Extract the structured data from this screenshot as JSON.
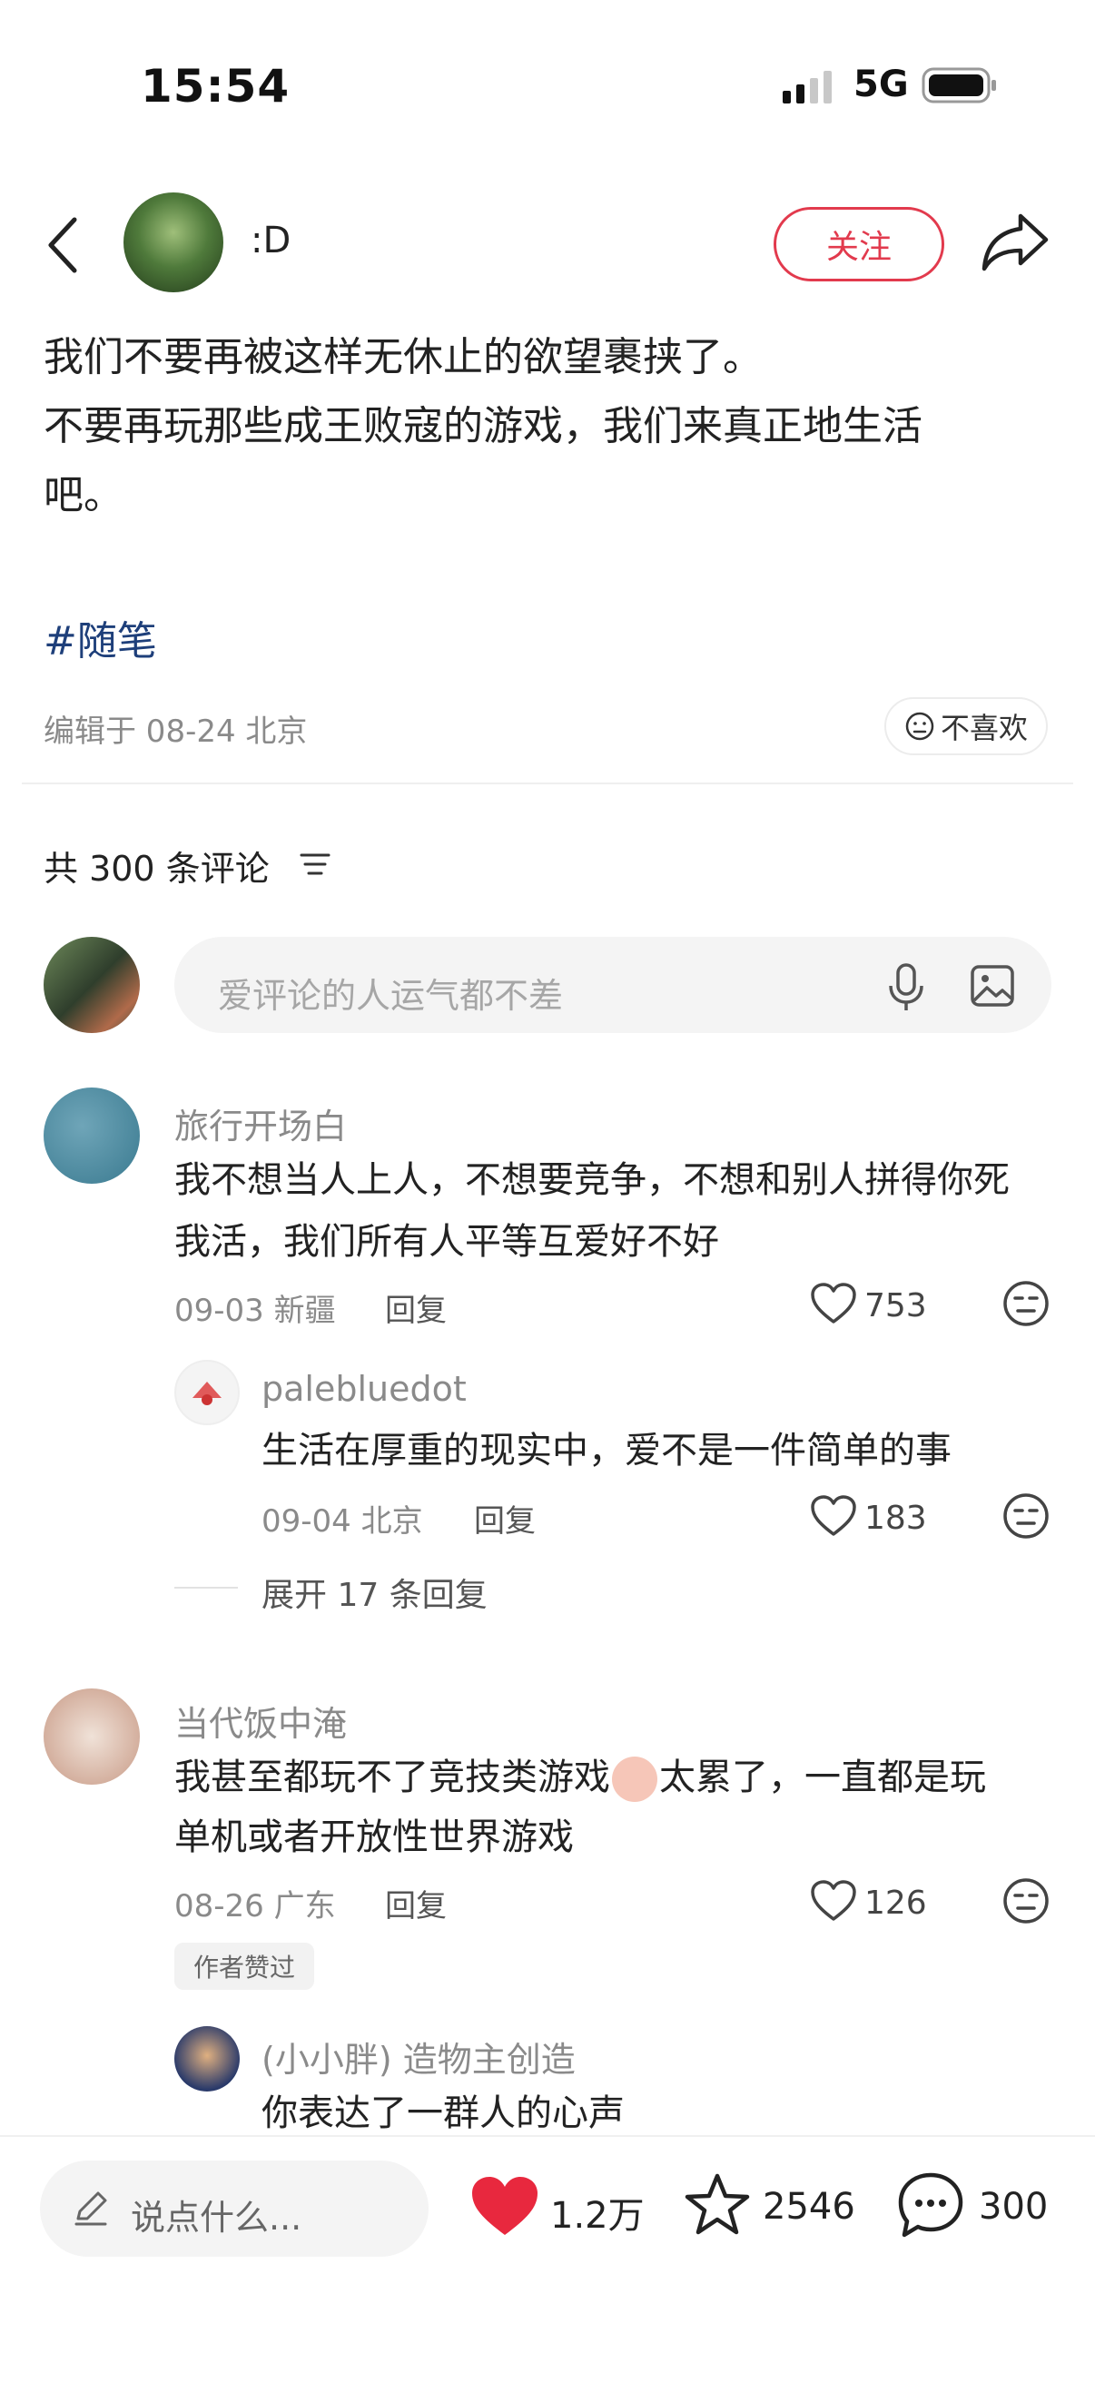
{
  "status_bar": {
    "time": "15:54",
    "network": "5G"
  },
  "header": {
    "author": ":D",
    "follow_label": "关注"
  },
  "post": {
    "lines": [
      "我们不要再被这样无休止的欲望裹挟了。",
      "不要再玩那些成王败寇的游戏，我们来真正地生活",
      "吧。"
    ],
    "tag": "#随笔",
    "meta": "编辑于 08-24 北京",
    "dislike_label": "不喜欢"
  },
  "comments_section": {
    "count_label": "共 300 条评论",
    "input_placeholder": "爱评论的人运气都不差"
  },
  "comments": [
    {
      "author": "旅行开场白",
      "text_lines": [
        "我不想当人上人，不想要竞争，不想和别人拼得你死",
        "我活，我们所有人平等互爱好不好"
      ],
      "meta": "09-03 新疆",
      "reply_label": "回复",
      "likes": "753"
    },
    {
      "author": "当代饭中淹",
      "text_lines": [
        "我甚至都玩不了竞技类游戏",
        "太累了，一直都是玩",
        "单机或者开放性世界游戏"
      ],
      "meta": "08-26 广东",
      "reply_label": "回复",
      "likes": "126",
      "badge": "作者赞过"
    }
  ],
  "sub_comments": [
    {
      "author": "palebluedot",
      "text": "生活在厚重的现实中，爱不是一件简单的事",
      "meta": "09-04 北京",
      "reply_label": "回复",
      "likes": "183",
      "expand_label": "展开 17 条回复"
    },
    {
      "author": "(小小胖) 造物主创造",
      "text": "你表达了一群人的心声"
    }
  ],
  "bottom_bar": {
    "input_placeholder": "说点什么...",
    "likes": "1.2万",
    "favorites": "2546",
    "comments": "300"
  },
  "colors": {
    "accent": "#e23a4d",
    "tag": "#1e3f7a",
    "muted": "#8a8a8a"
  }
}
